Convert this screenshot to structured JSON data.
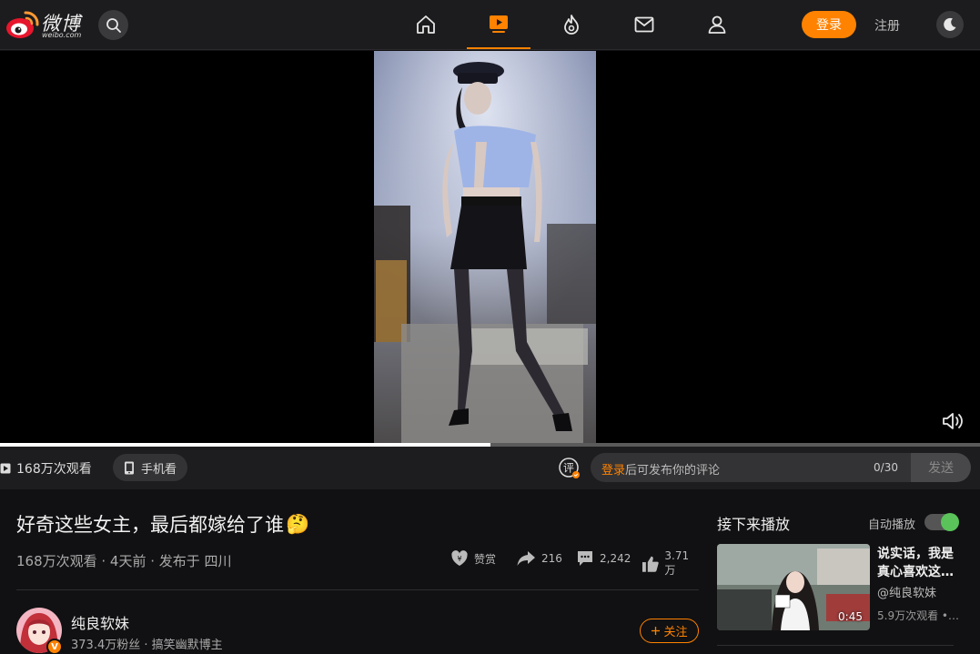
{
  "header": {
    "logo_text": "微博",
    "logo_sub": "weibo.com",
    "nav": [
      {
        "name": "home",
        "icon": "home-icon"
      },
      {
        "name": "video",
        "icon": "video-icon",
        "active": true
      },
      {
        "name": "hot",
        "icon": "flame-icon"
      },
      {
        "name": "messages",
        "icon": "mail-icon"
      },
      {
        "name": "profile",
        "icon": "user-icon"
      }
    ],
    "login_label": "登录",
    "register_label": "注册",
    "accent_color": "#ff8200"
  },
  "player": {
    "progress": 0.5
  },
  "subbar": {
    "views": "168万次观看",
    "mobile_label": "手机看",
    "comment_badge": "评",
    "comment_login": "登录",
    "comment_placeholder": "后可发布你的评论",
    "comment_count": "0/30",
    "send_label": "发送"
  },
  "video": {
    "title": "好奇这些女主，最后都嫁给了谁",
    "title_emoji": "🤔",
    "meta": "168万次观看 · 4天前 · 发布于 四川",
    "actions": {
      "reward_label": "赞赏",
      "share_count": "216",
      "comment_count": "2,242",
      "like_count": "3.71万"
    }
  },
  "author": {
    "name": "纯良软妹",
    "meta": "373.4万粉丝 · 搞笑幽默博主",
    "badge": "V",
    "follow_label": "关注"
  },
  "sidebar": {
    "next_title": "接下来播放",
    "autoplay_label": "自动播放",
    "autoplay_on": true,
    "items": [
      {
        "title": "说实话，我是真心喜欢这…",
        "author": "@纯良软妹",
        "views": "5.9万次观看 •…",
        "duration": "0:45"
      }
    ]
  }
}
